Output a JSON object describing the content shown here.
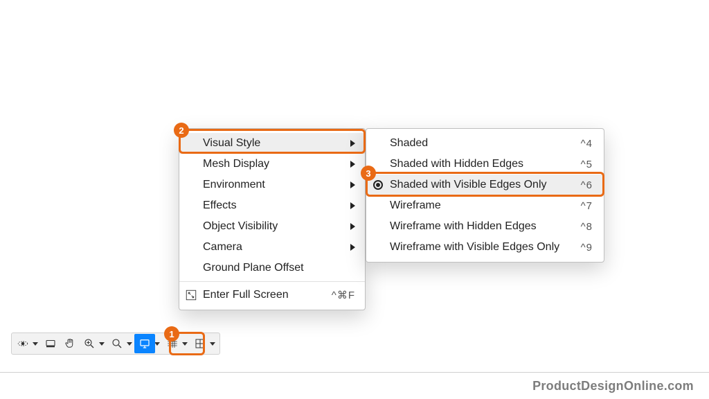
{
  "colors": {
    "accent_highlight": "#e96a15",
    "active_tool_bg": "#0a84ff"
  },
  "toolbar": {
    "items": [
      {
        "name": "orbit-tool",
        "has_dropdown": true
      },
      {
        "name": "look-at-tool",
        "has_dropdown": false
      },
      {
        "name": "pan-tool",
        "has_dropdown": false
      },
      {
        "name": "zoom-tool",
        "has_dropdown": true
      },
      {
        "name": "fit-tool",
        "has_dropdown": true
      },
      {
        "name": "display-settings-tool",
        "has_dropdown": true,
        "active": true
      },
      {
        "name": "grid-tool",
        "has_dropdown": true
      },
      {
        "name": "viewports-tool",
        "has_dropdown": true
      }
    ]
  },
  "menu": {
    "items": [
      {
        "label": "Visual Style",
        "has_submenu": true,
        "highlighted": true
      },
      {
        "label": "Mesh Display",
        "has_submenu": true
      },
      {
        "label": "Environment",
        "has_submenu": true
      },
      {
        "label": "Effects",
        "has_submenu": true
      },
      {
        "label": "Object Visibility",
        "has_submenu": true
      },
      {
        "label": "Camera",
        "has_submenu": true
      },
      {
        "label": "Ground Plane Offset",
        "has_submenu": false
      }
    ],
    "fullscreen": {
      "label": "Enter Full Screen",
      "shortcut": "^⌘F",
      "icon": "fullscreen-icon"
    }
  },
  "submenu": {
    "items": [
      {
        "label": "Shaded",
        "shortcut": "^4"
      },
      {
        "label": "Shaded with Hidden Edges",
        "shortcut": "^5"
      },
      {
        "label": "Shaded with Visible Edges Only",
        "shortcut": "^6",
        "selected": true,
        "highlighted": true
      },
      {
        "label": "Wireframe",
        "shortcut": "^7"
      },
      {
        "label": "Wireframe with Hidden Edges",
        "shortcut": "^8"
      },
      {
        "label": "Wireframe with Visible Edges Only",
        "shortcut": "^9"
      }
    ]
  },
  "callouts": {
    "1": "1",
    "2": "2",
    "3": "3"
  },
  "watermark": "ProductDesignOnline.com"
}
